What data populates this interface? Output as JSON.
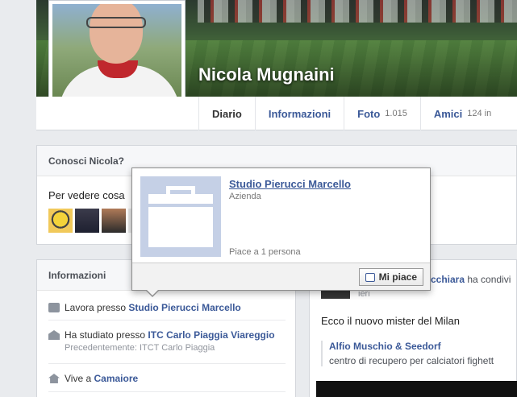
{
  "profile": {
    "name": "Nicola Mugnaini"
  },
  "tabs": [
    {
      "label": "Diario",
      "count": ""
    },
    {
      "label": "Informazioni",
      "count": ""
    },
    {
      "label": "Foto",
      "count": "1.015"
    },
    {
      "label": "Amici",
      "count": "124 in"
    }
  ],
  "know": {
    "title": "Conosci Nicola?",
    "text": "Per vedere cosa"
  },
  "info": {
    "title": "Informazioni",
    "work": {
      "prefix": "Lavora presso",
      "link": "Studio Pierucci Marcello"
    },
    "school": {
      "prefix": "Ha studiato presso",
      "link": "ITC Carlo Piaggia Viareggio",
      "previous": "Precedentemente: ITCT Carlo Piaggia"
    },
    "home": {
      "prefix": "Vive a",
      "link": "Camaiore"
    }
  },
  "feed": {
    "author_fragment": "cchiara",
    "author_rest": "ha condivi",
    "time": "ieri",
    "post_text": "Ecco il nuovo mister del Milan",
    "share_title": "Alfio Muschio & Seedorf",
    "share_desc": "centro di recupero per calciatori fighett"
  },
  "hovercard": {
    "name": "Studio Pierucci Marcello",
    "type": "Azienda",
    "likes": "Piace a 1 persona",
    "like_button": "Mi piace"
  },
  "icons": {
    "work": "briefcase-icon",
    "school": "school-icon",
    "home": "home-icon",
    "like": "thumbs-up-icon",
    "page_thumb": "briefcase-placeholder-icon"
  },
  "colors": {
    "link": "#3b5998",
    "background": "#e9ebee"
  }
}
